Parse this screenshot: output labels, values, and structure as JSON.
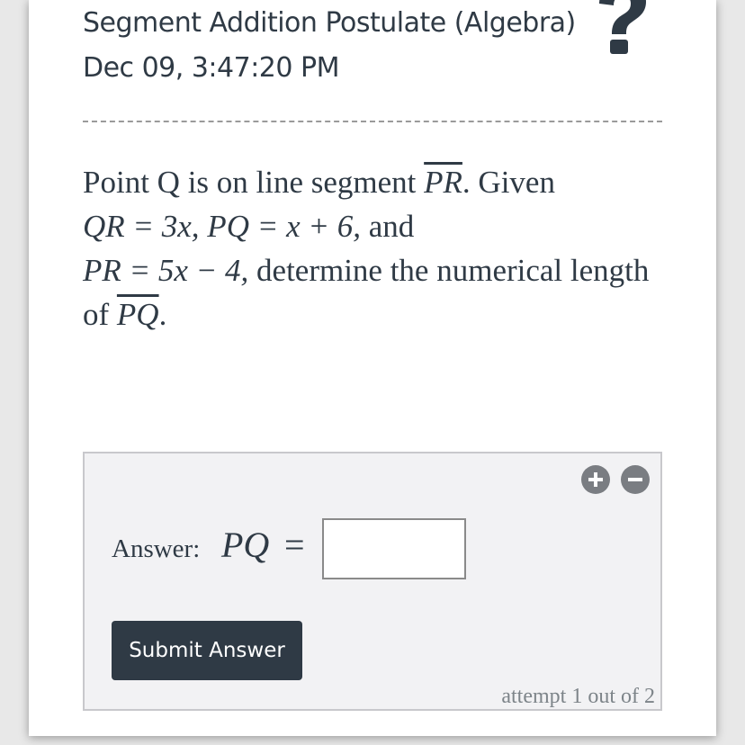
{
  "header": {
    "topic": "Segment Addition Postulate (Algebra)",
    "timestamp": "Dec 09, 3:47:20 PM",
    "help_icon": "question-mark-icon"
  },
  "question": {
    "p1": "Point Q is on line segment ",
    "seg1": "PR",
    "p2": ". Given",
    "m1": "QR = 3x, PQ = x + 6,",
    "p3": " and",
    "m2": "PR = 5x − 4,",
    "p4": " determine the numerical length of ",
    "seg2": "PQ",
    "p5": "."
  },
  "answer": {
    "label": "Answer:",
    "variable": "PQ",
    "equals": "=",
    "input_value": "",
    "add_icon": "plus-circle-icon",
    "remove_icon": "minus-circle-icon",
    "submit_label": "Submit Answer",
    "attempt_text": "attempt 1 out of 2"
  }
}
